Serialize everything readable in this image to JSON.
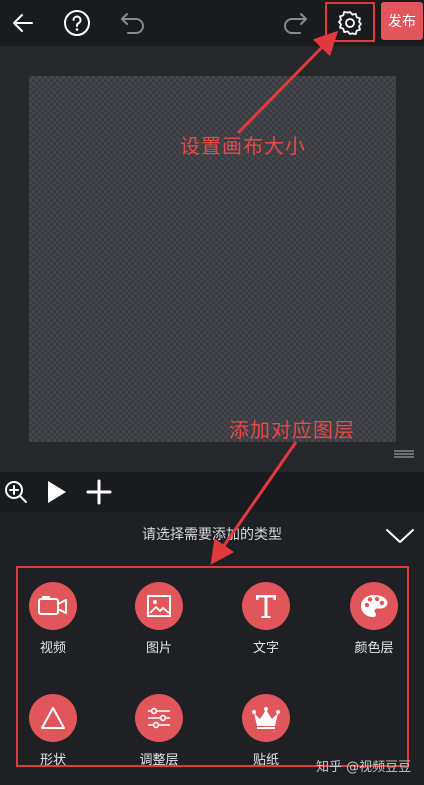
{
  "toolbar": {
    "publish_label": "发布",
    "icons": [
      "back-arrow-icon",
      "help-icon",
      "undo-icon",
      "redo-icon",
      "gear-icon"
    ]
  },
  "annotations": {
    "settings_callout": "设置画布大小",
    "layer_callout": "添加对应图层",
    "color": "#e03a3e"
  },
  "controls": {
    "icons": [
      "zoom-in-icon",
      "play-icon",
      "plus-icon"
    ]
  },
  "add_panel": {
    "prompt": "请选择需要添加的类型",
    "items": [
      {
        "label": "视频",
        "icon": "video-camera-icon"
      },
      {
        "label": "图片",
        "icon": "image-icon"
      },
      {
        "label": "文字",
        "icon": "text-icon"
      },
      {
        "label": "颜色层",
        "icon": "palette-icon"
      },
      {
        "label": "形状",
        "icon": "triangle-icon"
      },
      {
        "label": "调整层",
        "icon": "sliders-icon"
      },
      {
        "label": "贴纸",
        "icon": "crown-icon"
      }
    ],
    "accent": "#e0565b"
  },
  "watermark": "知乎 @视频豆豆"
}
